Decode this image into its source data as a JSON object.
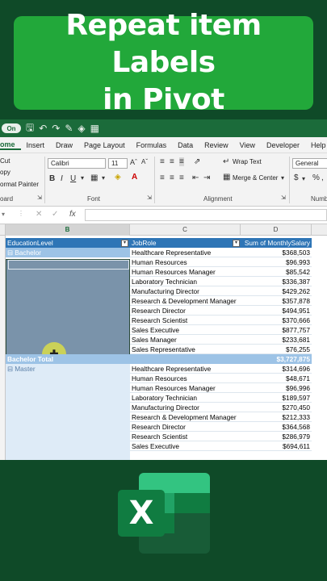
{
  "banner": {
    "line1": "Repeat item Labels",
    "line2": "in Pivot"
  },
  "titlebar": {
    "autosave": "On"
  },
  "menu": [
    "ome",
    "Insert",
    "Draw",
    "Page Layout",
    "Formulas",
    "Data",
    "Review",
    "View",
    "Developer",
    "Help"
  ],
  "ribbon": {
    "cut": "Cut",
    "copy": "opy",
    "format_painter": "ormat Painter",
    "clipboard": "oard",
    "font_name": "Calibri",
    "font_size": "11",
    "font_group": "Font",
    "wrap_text": "Wrap Text",
    "merge_center": "Merge & Center",
    "alignment_group": "Alignment",
    "number_format": "General",
    "number_group": "Numb"
  },
  "formula": {
    "fx": "fx"
  },
  "columns": {
    "b": "B",
    "c": "C",
    "d": "D"
  },
  "pivot": {
    "headers": {
      "b": "EducationLevel",
      "c": "JobRole",
      "d": "Sum of MonthlySalary"
    },
    "bachelor_label": "Bachelor",
    "bachelor_rows": [
      {
        "role": "Healthcare Representative",
        "value": "$368,503"
      },
      {
        "role": "Human Resources",
        "value": "$96,993"
      },
      {
        "role": "Human Resources Manager",
        "value": "$85,542"
      },
      {
        "role": "Laboratory Technician",
        "value": "$336,387"
      },
      {
        "role": "Manufacturing Director",
        "value": "$429,262"
      },
      {
        "role": "Research & Development Manager",
        "value": "$357,878"
      },
      {
        "role": "Research Director",
        "value": "$494,951"
      },
      {
        "role": "Research Scientist",
        "value": "$370,666"
      },
      {
        "role": "Sales Executive",
        "value": "$877,757"
      },
      {
        "role": "Sales Manager",
        "value": "$233,681"
      },
      {
        "role": "Sales Representative",
        "value": "$76,255"
      }
    ],
    "bachelor_total_label": "Bachelor Total",
    "bachelor_total_value": "$3,727,875",
    "master_label": "Master",
    "master_rows": [
      {
        "role": "Healthcare Representative",
        "value": "$314,696"
      },
      {
        "role": "Human Resources",
        "value": "$48,671"
      },
      {
        "role": "Human Resources Manager",
        "value": "$96,996"
      },
      {
        "role": "Laboratory Technician",
        "value": "$189,597"
      },
      {
        "role": "Manufacturing Director",
        "value": "$270,450"
      },
      {
        "role": "Research & Development Manager",
        "value": "$212,333"
      },
      {
        "role": "Research Director",
        "value": "$364,568"
      },
      {
        "role": "Research Scientist",
        "value": "$286,979"
      },
      {
        "role": "Sales Executive",
        "value": "$694,611"
      }
    ]
  },
  "logo": {
    "letter": "X"
  },
  "colors": {
    "banner_bg": "#0f4a28",
    "title_box": "#22a83a",
    "pivot_header": "#2e75b6",
    "total_row": "#9dc3e6"
  }
}
